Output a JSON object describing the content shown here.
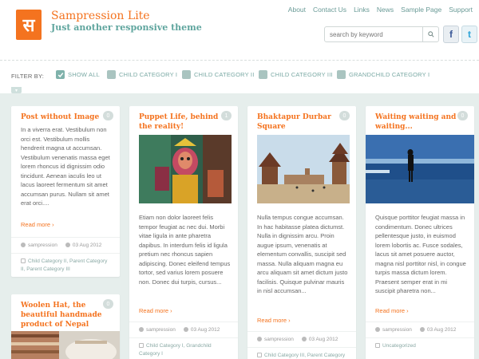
{
  "site": {
    "logo_glyph": "स",
    "title": "Sampression Lite",
    "description": "Just another responsive theme"
  },
  "topnav": [
    "About",
    "Contact Us",
    "Links",
    "News",
    "Sample Page",
    "Support"
  ],
  "search": {
    "placeholder": "search by keyword"
  },
  "social": {
    "facebook": "f",
    "twitter": "t"
  },
  "filter": {
    "label": "FILTER BY:",
    "items": [
      {
        "label": "SHOW ALL",
        "checked": true
      },
      {
        "label": "CHILD CATEGORY I",
        "checked": false
      },
      {
        "label": "CHILD CATEGORY II",
        "checked": false
      },
      {
        "label": "CHILD CATEGORY III",
        "checked": false
      },
      {
        "label": "GRANDCHILD CATEGORY I",
        "checked": false
      }
    ]
  },
  "posts": [
    {
      "title": "Post without Image",
      "comments": "0",
      "excerpt": "In a viverra erat. Vestibulum non orci est. Vestibulum mollis hendrerit magna ut accumsan. Vestibulum venenatis massa eget lorem rhoncus id dignissim odio tincidunt. Aenean iaculis leo ut lacus laoreet fermentum sit amet accumsan purus. Nullam sit amet erat orci....",
      "read_more": "Read more ›",
      "author": "sampression",
      "date": "03 Aug 2012",
      "categories": "Child Category II, Parent Category II, Parent Category III"
    },
    {
      "title": "Puppet Life, behind the reality!",
      "comments": "1",
      "excerpt": "Etiam non dolor laoreet felis tempor feugiat ac nec dui. Morbi vitae ligula in ante pharetra dapibus. In interdum felis id ligula pretium nec rhoncus sapien adipiscing. Donec eleifend tempus tortor, sed varius lorem posuere non. Donec dui turpis, cursus...",
      "read_more": "Read more ›",
      "author": "sampression",
      "date": "03 Aug 2012",
      "categories": "Child Category I, Grandchild Category I"
    },
    {
      "title": "Bhaktapur Durbar Square",
      "comments": "0",
      "excerpt": "Nulla tempus congue accumsan. In hac habitasse platea dictumst. Nulla in dignissim arcu. Proin augue ipsum, venenatis at elementum convallis, suscipit sed massa. Nulla aliquam magna eu arcu aliquam sit amet dictum justo facilisis. Quisque pulvinar mauris in nisl accumsan...",
      "read_more": "Read more ›",
      "author": "sampression",
      "date": "03 Aug 2012",
      "categories": "Child Category III, Parent Category III"
    },
    {
      "title": "Waiting waiting and waiting...",
      "comments": "0",
      "excerpt": "Quisque porttitor feugiat massa in condimentum. Donec ultrices pellentesque justo, in euismod lorem lobortis ac. Fusce sodales, lacus sit amet posuere auctor, magna nisl porttitor nisl, in congue turpis massa dictum lorem. Praesent semper erat in mi suscipit pharetra non...",
      "read_more": "Read more ›",
      "author": "sampression",
      "date": "03 Aug 2012",
      "categories": "Uncategorized"
    },
    {
      "title": "Woolen Hat, the beautiful handmade product of Nepal",
      "comments": "0"
    }
  ]
}
